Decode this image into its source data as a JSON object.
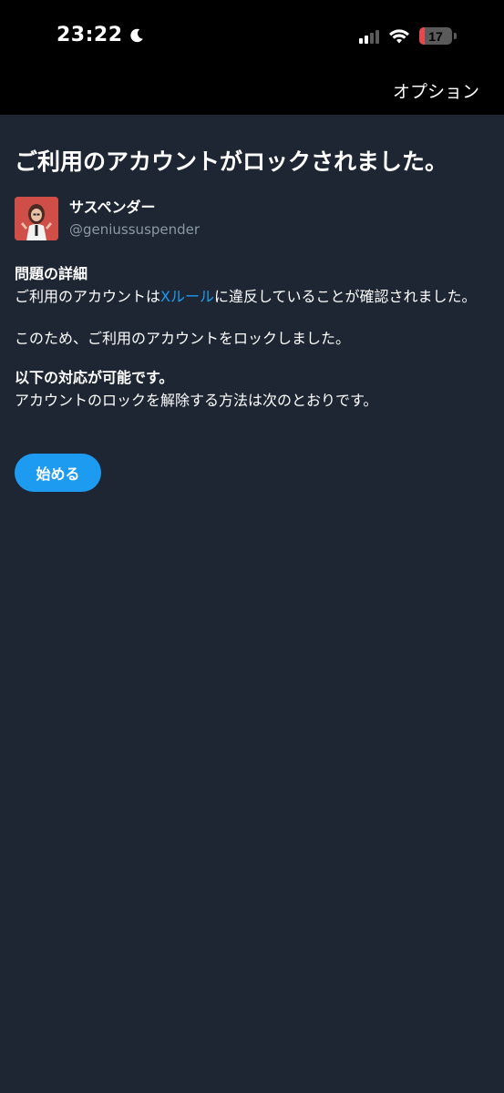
{
  "status_bar": {
    "time": "23:22",
    "battery_level": "17",
    "battery_fraction": 0.17,
    "moon_icon": "moon-icon",
    "wifi_icon": "wifi-icon",
    "signal_icon": "cellular-signal-icon"
  },
  "header": {
    "options_label": "オプション"
  },
  "main": {
    "title": "ご利用のアカウントがロックされました。",
    "account": {
      "name": "サスペンダー",
      "handle": "@geniussuspender"
    },
    "details": {
      "heading": "問題の詳細",
      "text_before_link": "ご利用のアカウントは",
      "link_text": "Xルール",
      "text_after_link": "に違反していることが確認されました。",
      "locked_text": "このため、ご利用のアカウントをロックしました。"
    },
    "actions": {
      "heading": "以下の対応が可能です。",
      "text": "アカウントのロックを解除する方法は次のとおりです。"
    },
    "start_button_label": "始める"
  },
  "colors": {
    "background": "#1e2633",
    "accent": "#1d9bf0",
    "battery_low": "#e5484d"
  }
}
